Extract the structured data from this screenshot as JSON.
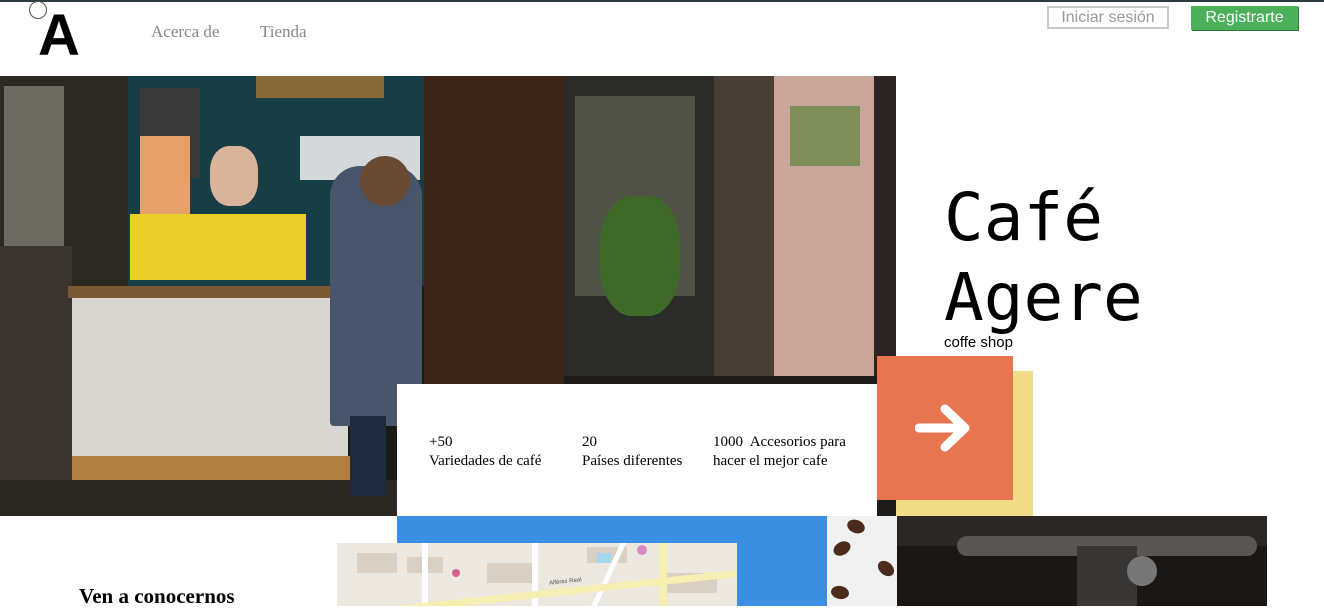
{
  "header": {
    "logo": "A",
    "nav": [
      {
        "label": "Acerca de"
      },
      {
        "label": "Tienda"
      }
    ],
    "login_label": "Iniciar sesión",
    "register_label": "Registrarte"
  },
  "hero": {
    "title_line1": "Café",
    "title_line2": "Agere",
    "subtitle": "coffe shop"
  },
  "stats": [
    {
      "value": "+50",
      "label": "Variedades de café"
    },
    {
      "value": "20",
      "label": "Países diferentes"
    },
    {
      "value": "1000",
      "label_line1": "Accesorios para",
      "label_line2": "hacer el mejor cafe"
    }
  ],
  "cta": {
    "icon": "arrow-right-icon"
  },
  "visit": {
    "heading": "Ven a conocernos"
  },
  "map": {
    "street": "Alférez Real"
  },
  "colors": {
    "register_green": "#4caf5a",
    "cta_orange": "#e77550",
    "accent_yellow": "#f2dc87",
    "map_blue": "#3b8ee1"
  }
}
